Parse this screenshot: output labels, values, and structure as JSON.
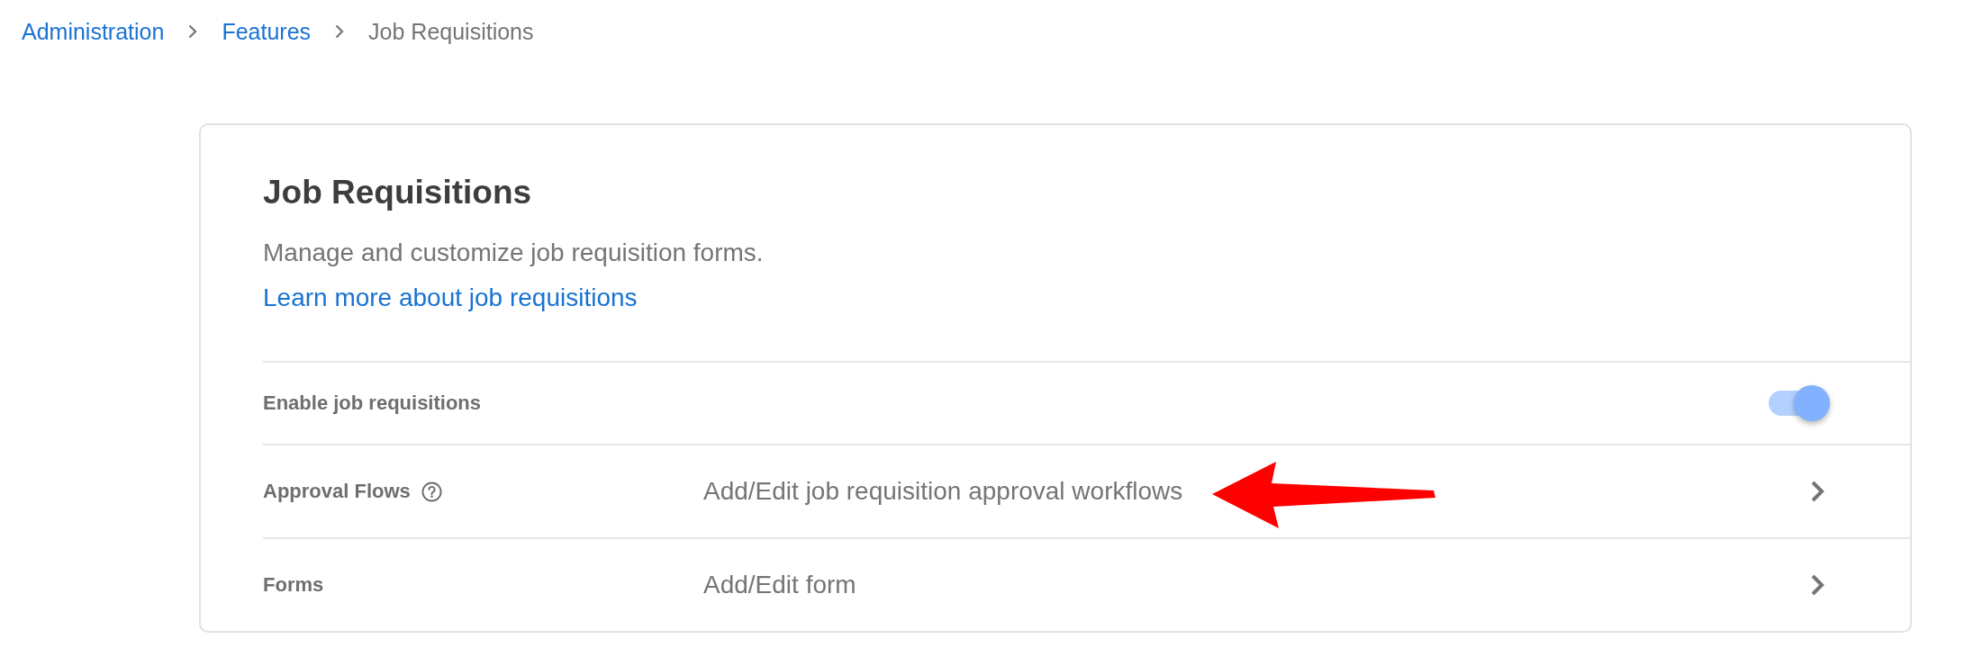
{
  "breadcrumb": [
    {
      "label": "Administration",
      "current": false
    },
    {
      "label": "Features",
      "current": false
    },
    {
      "label": "Job Requisitions",
      "current": true
    }
  ],
  "card": {
    "title": "Job Requisitions",
    "description": "Manage and customize job requisition forms.",
    "learn_more": "Learn more about job requisitions"
  },
  "settings": [
    {
      "kind": "toggle",
      "label": "Enable job requisitions",
      "help": false,
      "checked": true
    },
    {
      "kind": "link",
      "label": "Approval Flows",
      "help": true,
      "value": "Add/Edit job requisition approval workflows"
    },
    {
      "kind": "link",
      "label": "Forms",
      "help": false,
      "value": "Add/Edit form"
    }
  ]
}
